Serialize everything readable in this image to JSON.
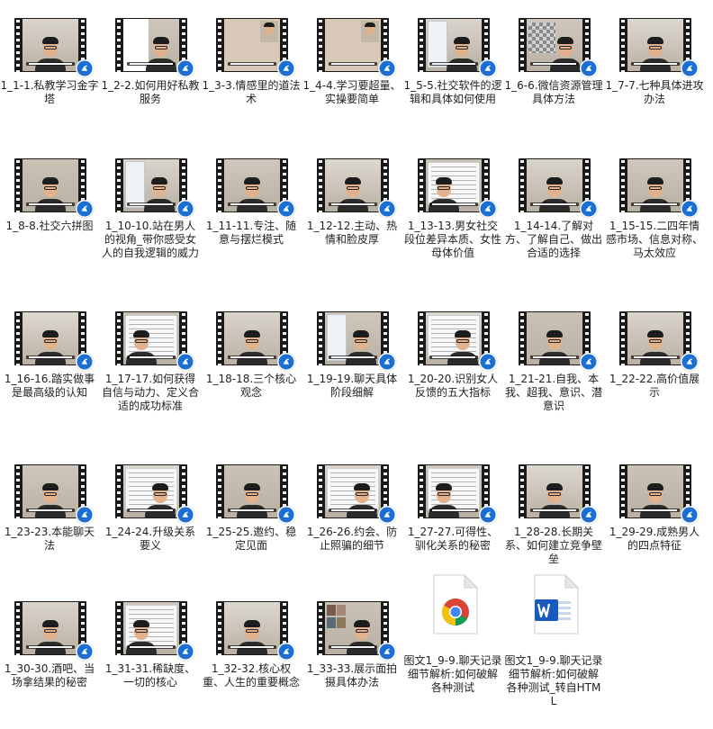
{
  "colors": {
    "badge_blue": "#1b6fd1",
    "chrome_red": "#db4437",
    "chrome_yellow": "#f4c20d",
    "chrome_green": "#0f9d58",
    "chrome_blue": "#4285f4",
    "word_blue": "#185abd"
  },
  "videos": [
    {
      "name": "1_1-1.私教学习金字塔",
      "scene": "person-glasses"
    },
    {
      "name": "1_2-2.如何用好私教服务",
      "scene": "blank-person"
    },
    {
      "name": "1_3-3.情感里的道法术",
      "scene": "beige-panel"
    },
    {
      "name": "1_4-4.学习要超量、实操要简单",
      "scene": "beige-panel-2"
    },
    {
      "name": "1_5-5.社交软件的逻辑和具体如何使用",
      "scene": "phone-person"
    },
    {
      "name": "1_6-6.微信资源管理具体方法",
      "scene": "grid-person"
    },
    {
      "name": "1_7-7.七种具体进攻办法",
      "scene": "person-glasses"
    },
    {
      "name": "1_8-8.社交六拼图",
      "scene": "person-glasses"
    },
    {
      "name": "1_10-10.站在男人的视角_带你感受女人的自我逻辑的威力",
      "scene": "phone-person"
    },
    {
      "name": "1_11-11.专注、随意与摆烂模式",
      "scene": "person-glasses"
    },
    {
      "name": "1_12-12.主动、热情和脸皮厚",
      "scene": "person-glasses"
    },
    {
      "name": "1_13-13.男女社交段位差异本质、女性母体价值",
      "scene": "whiteboard-person"
    },
    {
      "name": "1_14-14.了解对方、了解自己、做出合适的选择",
      "scene": "person-glasses"
    },
    {
      "name": "1_15-15.二四年情感市场、信息对称、马太效应",
      "scene": "person-glasses"
    },
    {
      "name": "1_16-16.踏实做事是最高级的认知",
      "scene": "person-glasses"
    },
    {
      "name": "1_17-17.如何获得自信与动力、定义合适的成功标准",
      "scene": "whiteboard-person"
    },
    {
      "name": "1_18-18.三个核心观念",
      "scene": "person-glasses"
    },
    {
      "name": "1_19-19.聊天具体阶段细解",
      "scene": "phone-person"
    },
    {
      "name": "1_20-20.识别女人反馈的五大指标",
      "scene": "whiteboard-person"
    },
    {
      "name": "1_21-21.自我、本我、超我、意识、潜意识",
      "scene": "person-glasses"
    },
    {
      "name": "1_22-22.高价值展示",
      "scene": "person-glasses"
    },
    {
      "name": "1_23-23.本能聊天法",
      "scene": "person-glasses"
    },
    {
      "name": "1_24-24.升级关系要义",
      "scene": "whiteboard-person"
    },
    {
      "name": "1_25-25.邀约、稳定见面",
      "scene": "person-glasses"
    },
    {
      "name": "1_26-26.约会、防止照骗的细节",
      "scene": "whiteboard-person"
    },
    {
      "name": "1_27-27.可得性、驯化关系的秘密",
      "scene": "whiteboard-person"
    },
    {
      "name": "1_28-28.长期关系、如何建立竞争壁垒",
      "scene": "person-glasses"
    },
    {
      "name": "1_29-29.成熟男人的四点特征",
      "scene": "person-glasses"
    },
    {
      "name": "1_30-30.酒吧、当场拿结果的秘密",
      "scene": "person-glasses"
    },
    {
      "name": "1_31-31.稀缺度、一切的核心",
      "scene": "whiteboard-person"
    },
    {
      "name": "1_32-32.核心权重、人生的重要概念",
      "scene": "person-glasses"
    },
    {
      "name": "1_33-33.展示面拍摄具体办法",
      "scene": "photos-person"
    }
  ],
  "documents": [
    {
      "name": "图文1_9-9.聊天记录细节解析:如何破解各种测试",
      "icon": "chrome-icon"
    },
    {
      "name": "图文1_9-9.聊天记录细节解析:如何破解各种测试_转自HTML",
      "icon": "word-icon"
    }
  ]
}
